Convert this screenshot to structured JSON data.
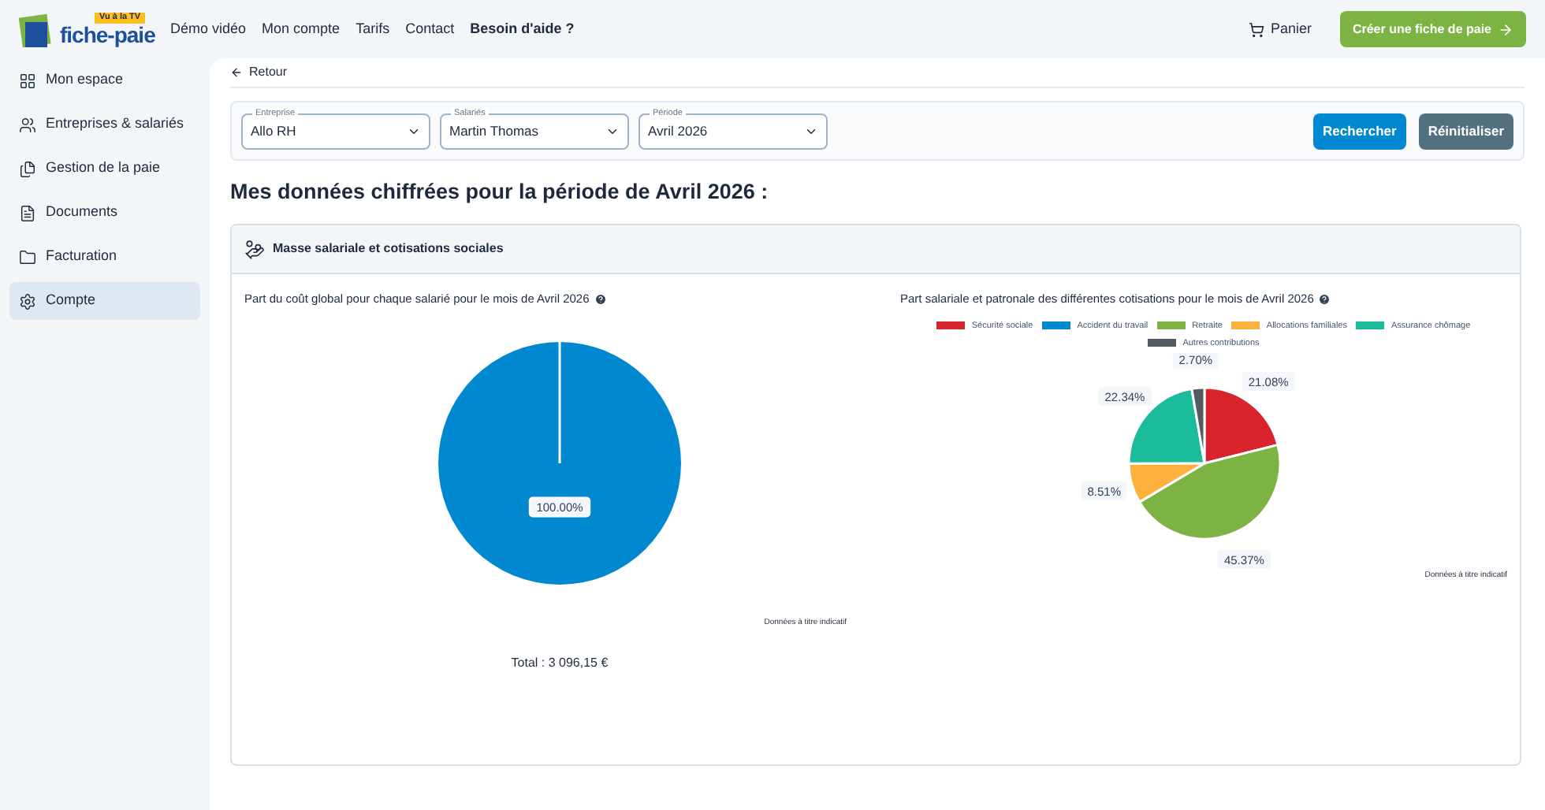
{
  "header": {
    "logo": {
      "name": "fiche-paie",
      "badge": "Vu à la TV"
    },
    "nav": [
      {
        "label": "Démo vidéo",
        "bold": false
      },
      {
        "label": "Mon compte",
        "bold": false
      },
      {
        "label": "Tarifs",
        "bold": false
      },
      {
        "label": "Contact",
        "bold": false
      },
      {
        "label": "Besoin d'aide ?",
        "bold": true
      }
    ],
    "cart": "Panier",
    "cta": "Créer une fiche de paie"
  },
  "sidebar": {
    "items": [
      {
        "label": "Mon espace",
        "selected": false
      },
      {
        "label": "Entreprises & salariés",
        "selected": false
      },
      {
        "label": "Gestion de la paie",
        "selected": false
      },
      {
        "label": "Documents",
        "selected": false
      },
      {
        "label": "Facturation",
        "selected": false
      },
      {
        "label": "Compte",
        "selected": true
      }
    ]
  },
  "back": "Retour",
  "filters": [
    {
      "label": "Entreprise",
      "value": "Allo RH"
    },
    {
      "label": "Salariés",
      "value": "Martin Thomas"
    },
    {
      "label": "Période",
      "value": "Avril 2026"
    }
  ],
  "buttons": [
    {
      "label": "Rechercher",
      "kind": "primary"
    },
    {
      "label": "Réinitialiser",
      "kind": "secondary"
    }
  ],
  "heading": "Mes données chiffrées pour la période de Avril 2026 :",
  "section": {
    "title": "Masse salariale et cotisations sociales",
    "charts": [
      {
        "title": "Part du coût global pour chaque salarié pour le mois de Avril 2026",
        "note": "Données à titre indicatif",
        "footer": "Total : 3 096,15 €",
        "chart_data": {
          "type": "pie",
          "values": [
            100
          ],
          "colors": [
            "#0088d1"
          ],
          "value_labels": [
            "100.00%"
          ]
        }
      },
      {
        "title": "Part salariale et patronale des différentes cotisations pour le mois de Avril 2026",
        "note": "Données à titre indicatif",
        "chart_data": {
          "type": "pie",
          "categories": [
            "Sécurité sociale",
            "Accident du travail",
            "Retraite",
            "Allocations familiales",
            "Assurance chômage",
            "Autres contributions"
          ],
          "values": [
            21.08,
            0,
            45.37,
            8.51,
            22.34,
            2.7
          ],
          "colors": [
            "#d9232d",
            "#0088d1",
            "#7cb342",
            "#fbb13c",
            "#1abc9c",
            "#555a5f"
          ],
          "value_labels": [
            "21.08%",
            null,
            "45.37%",
            "8.51%",
            "22.34%",
            "2.70%"
          ]
        }
      }
    ]
  }
}
